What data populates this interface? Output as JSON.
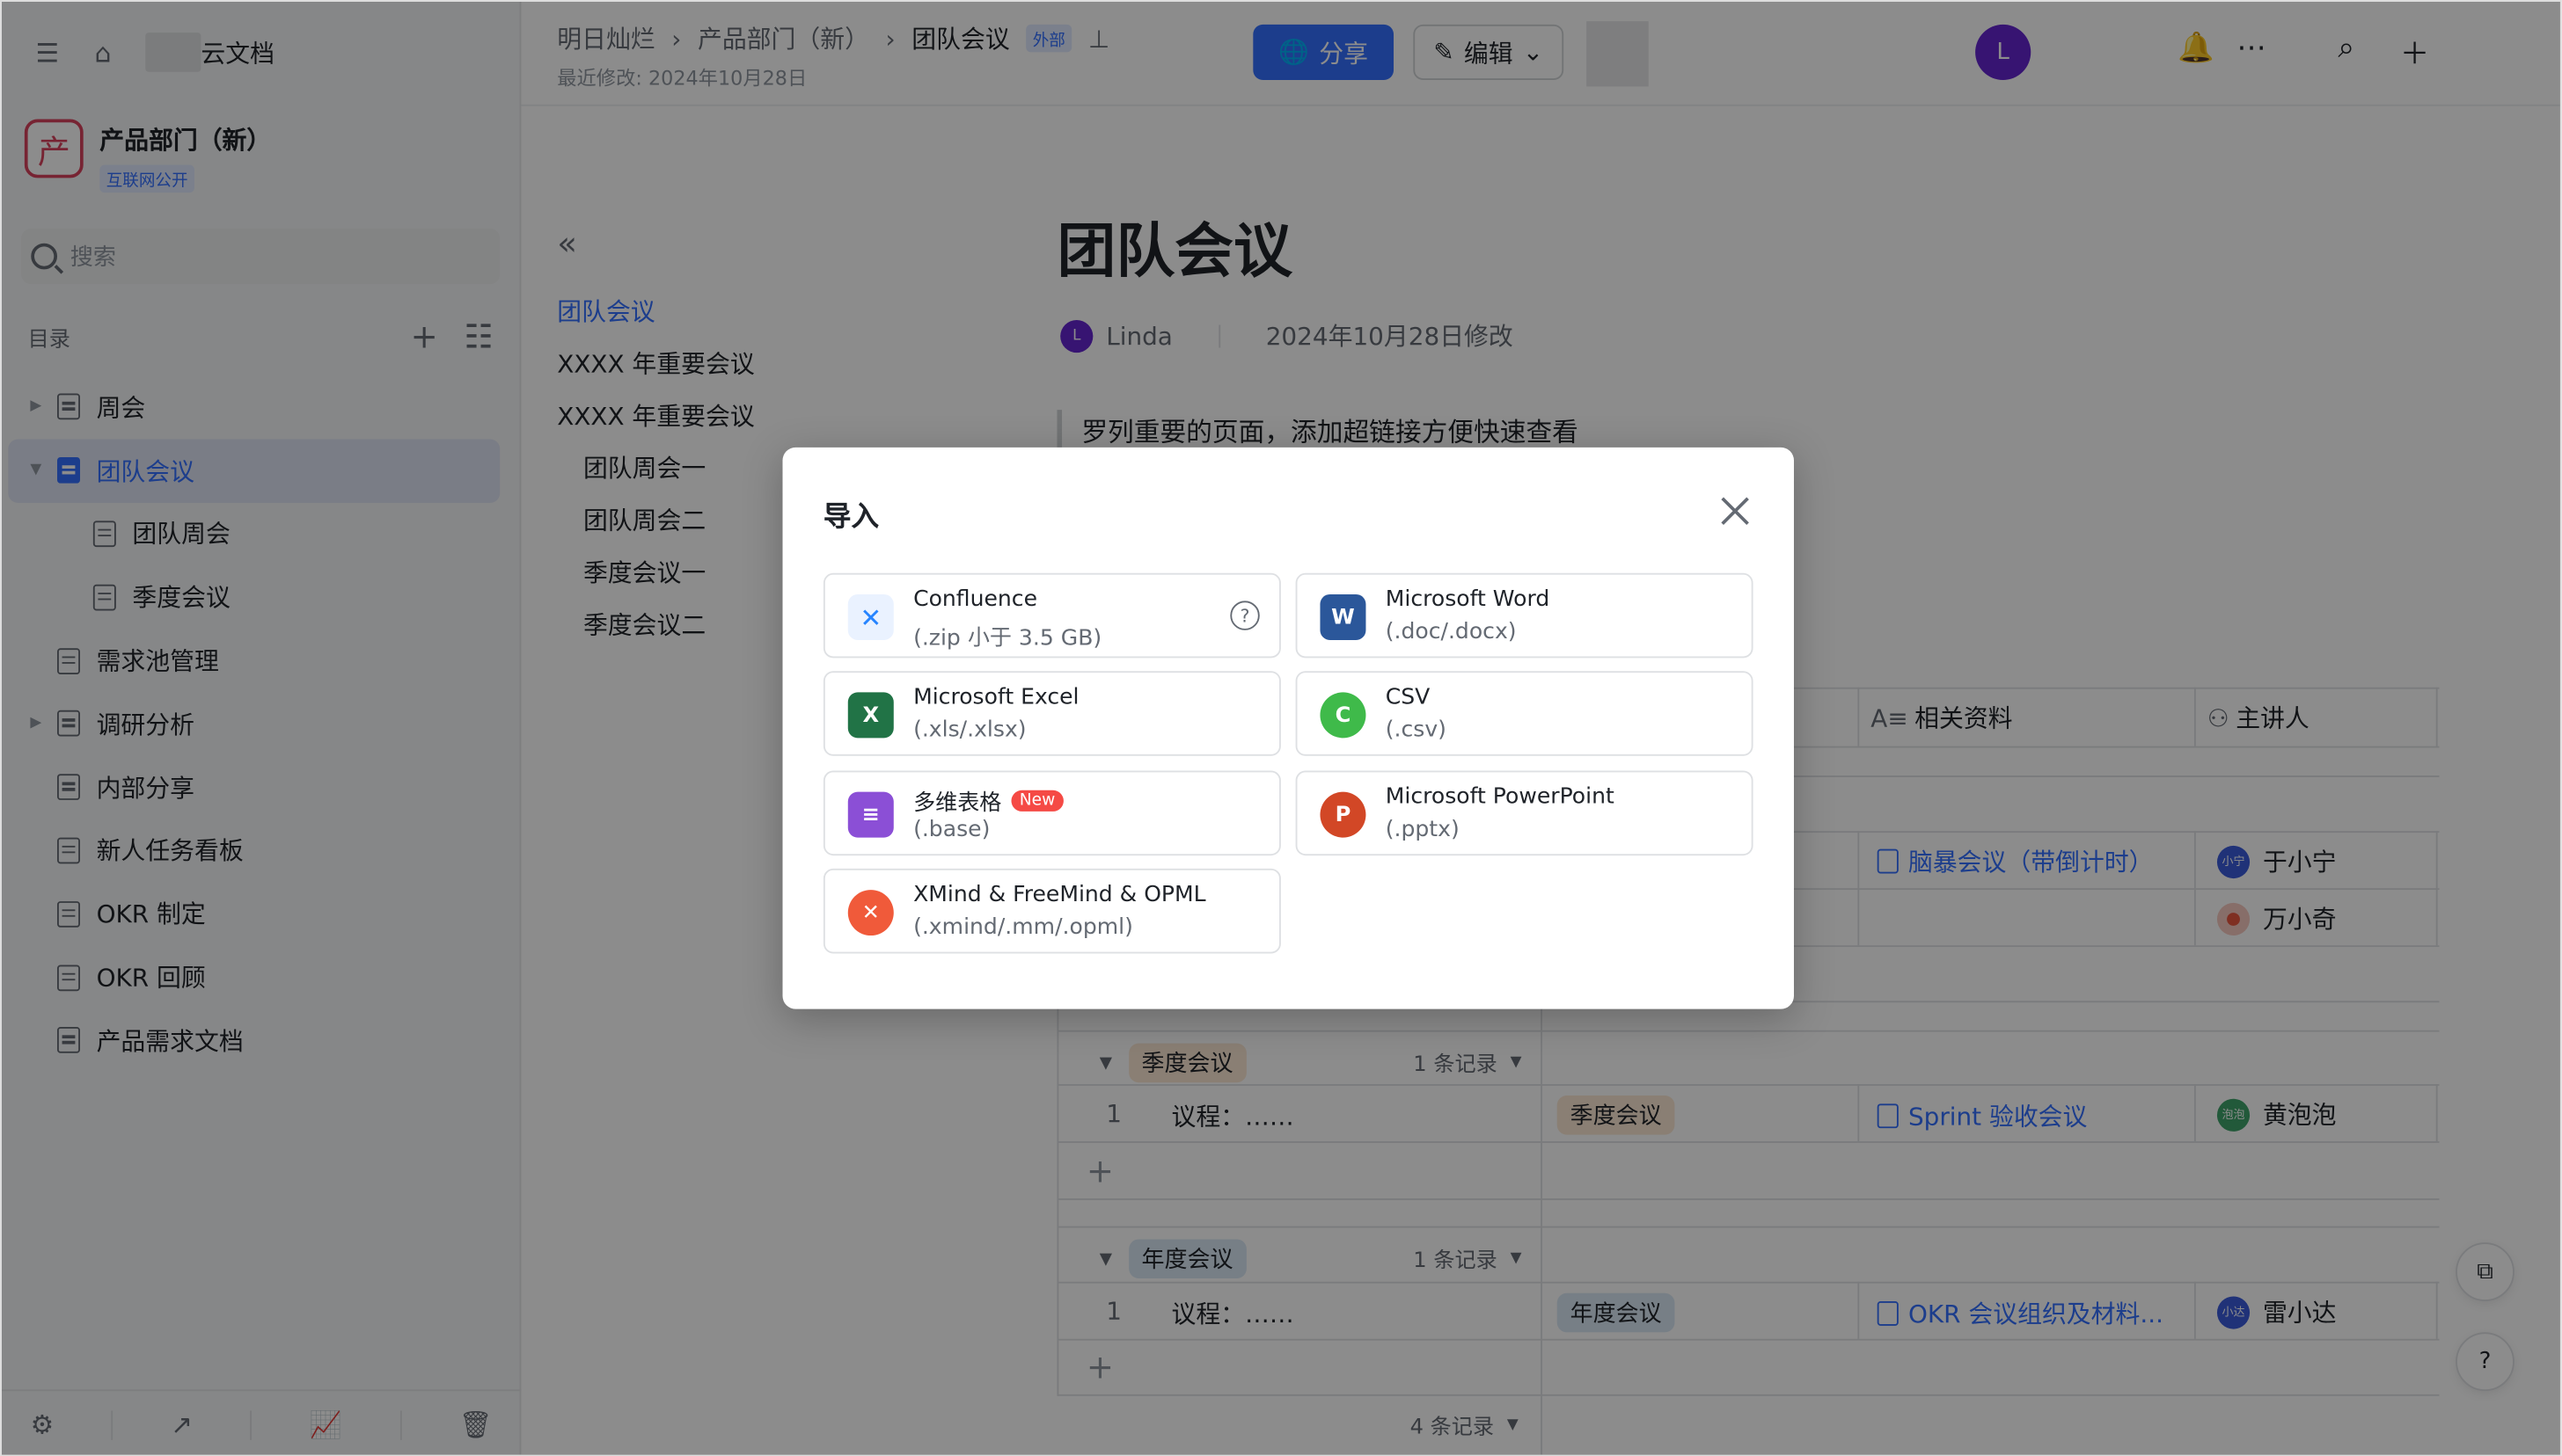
{
  "sidebar": {
    "brand": "云文档",
    "space_name": "产品部门（新）",
    "space_logo_char": "产",
    "space_tag": "互联网公开",
    "search_placeholder": "搜索",
    "toc_label": "目录",
    "items": [
      {
        "label": "周会"
      },
      {
        "label": "团队会议"
      },
      {
        "label": "团队周会"
      },
      {
        "label": "季度会议"
      },
      {
        "label": "需求池管理"
      },
      {
        "label": "调研分析"
      },
      {
        "label": "内部分享"
      },
      {
        "label": "新人任务看板"
      },
      {
        "label": "OKR 制定"
      },
      {
        "label": "OKR 回顾"
      },
      {
        "label": "产品需求文档"
      }
    ]
  },
  "header": {
    "crumb1": "明日灿烂",
    "crumb2": "产品部门（新）",
    "crumb3": "团队会议",
    "ext_tag": "外部",
    "modified": "最近修改: 2024年10月28日",
    "share_label": "分享",
    "edit_label": "编辑",
    "avatar_letter": "L"
  },
  "outline": {
    "items": [
      {
        "label": "团队会议"
      },
      {
        "label": "XXXX 年重要会议"
      },
      {
        "label": "XXXX 年重要会议"
      },
      {
        "label": "团队周会一"
      },
      {
        "label": "团队周会二"
      },
      {
        "label": "季度会议一"
      },
      {
        "label": "季度会议二"
      }
    ]
  },
  "doc": {
    "title": "团队会议",
    "author": "Linda",
    "author_initial": "L",
    "modified": "2024年10月28日修改",
    "quote": "罗列重要的页面，添加超链接方便快速查看"
  },
  "table": {
    "col_ref": "相关资料",
    "col_speaker": "主讲人",
    "rows_top": [
      {
        "ref": "脑暴会议（带倒计时）",
        "speaker": "于小宁",
        "speaker_short": "小宁",
        "color": "#3b5bdb"
      },
      {
        "ref": "",
        "speaker": "万小奇",
        "speaker_short": "",
        "color": "#e8563f"
      }
    ],
    "group_q": {
      "tag": "季度会议",
      "records": "1 条记录",
      "index": "1",
      "agenda": "议程：……",
      "type_tag": "季度会议",
      "ref": "Sprint 验收会议",
      "speaker": "黄泡泡",
      "speaker_short": "泡泡",
      "color": "#3fa36b"
    },
    "group_y": {
      "tag": "年度会议",
      "records": "1 条记录",
      "index": "1",
      "agenda": "议程：……",
      "type_tag": "年度会议",
      "ref": "OKR 会议组织及材料...",
      "speaker": "雷小达",
      "speaker_short": "小达",
      "color": "#3b5bdb"
    },
    "total_records": "4 条记录"
  },
  "dialog": {
    "title": "导入",
    "options": [
      {
        "name": "Confluence",
        "ext": "(.zip 小于 3.5 GB)",
        "icon": "confluence-icon",
        "color": "#2684ff"
      },
      {
        "name": "Microsoft Word",
        "ext": "(.doc/.docx)",
        "icon": "word-icon",
        "color": "#2b579a"
      },
      {
        "name": "Microsoft Excel",
        "ext": "(.xls/.xlsx)",
        "icon": "excel-icon",
        "color": "#217346"
      },
      {
        "name": "CSV",
        "ext": "(.csv)",
        "icon": "csv-icon",
        "color": "#3fba4a"
      },
      {
        "name": "多维表格",
        "ext": "(.base)",
        "icon": "base-icon",
        "color": "#8b4fd6",
        "badge": "New"
      },
      {
        "name": "Microsoft PowerPoint",
        "ext": "(.pptx)",
        "icon": "powerpoint-icon",
        "color": "#d24726"
      },
      {
        "name": "XMind & FreeMind & OPML",
        "ext": "(.xmind/.mm/.opml)",
        "icon": "mindmap-icon",
        "color": "#f05a3a"
      }
    ]
  }
}
